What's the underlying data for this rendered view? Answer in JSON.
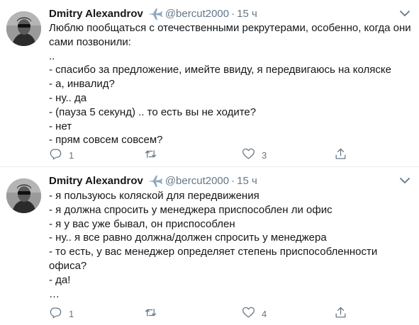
{
  "tweets": [
    {
      "author": "Dmitry Alexandrov",
      "handle": "@bercut2000",
      "separator": "·",
      "time": "15 ч",
      "lines": [
        "Люблю пообщаться с отечественными рекрутерами, особенно, когда они",
        "сами позвонили:",
        "..",
        "- спасибо за предложение, имейте ввиду, я передвигаюсь на коляске",
        "- а, инвалид?",
        "- ну.. да",
        "- (пауза 5 секунд) .. то есть вы не ходите?",
        "- нет",
        "- прям совсем совсем?"
      ],
      "reply_count": "1",
      "retweet_count": "",
      "like_count": "3",
      "icons": {
        "badge": "airplane-icon",
        "reply": "reply-icon",
        "retweet": "retweet-icon",
        "like": "heart-icon",
        "share": "share-icon",
        "caret": "chevron-down-icon"
      }
    },
    {
      "author": "Dmitry Alexandrov",
      "handle": "@bercut2000",
      "separator": "·",
      "time": "15 ч",
      "lines": [
        "- я пользуюсь коляской для передвижения",
        "- я должна спросить у менеджера приспособлен ли офис",
        "- я у вас уже бывал, он приспособлен",
        "- ну.. я все равно должна/должен спросить у менеджера",
        "- то есть, у вас менеджер определяет степень приспособленности",
        "офиса?",
        "- да!",
        "…"
      ],
      "reply_count": "1",
      "retweet_count": "",
      "like_count": "4",
      "icons": {
        "badge": "airplane-icon",
        "reply": "reply-icon",
        "retweet": "retweet-icon",
        "like": "heart-icon",
        "share": "share-icon",
        "caret": "chevron-down-icon"
      }
    }
  ],
  "colors": {
    "text": "#14171a",
    "secondary": "#657786",
    "divider": "#e6ecf0",
    "badge": "#1da1f2"
  }
}
